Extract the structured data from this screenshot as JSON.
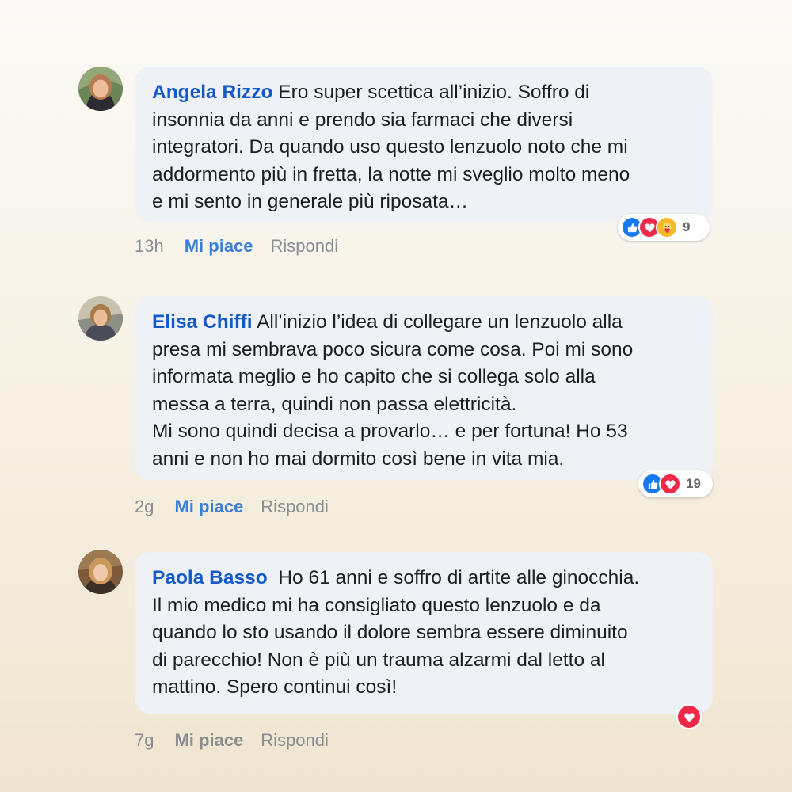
{
  "colors": {
    "author": "#1359c9",
    "like_active": "#3b7fd9",
    "like_inactive": "#8a8d91",
    "bubble": "#eef1f5"
  },
  "comments": [
    {
      "author": "Angela Rizzo",
      "text": "Ero super scettica all’inizio. Soffro di\ninsonnia da anni e prendo sia farmaci che diversi\nintegratori. Da quando uso questo lenzuolo noto che mi\naddormento più in fretta, la notte mi sveglio molto meno\ne mi sento in generale più riposata…",
      "reactions": {
        "icons": [
          "like-icon",
          "love-icon",
          "care-icon"
        ],
        "count": "9"
      },
      "time": "13h",
      "like_label": "Mi piace",
      "like_active": true,
      "reply_label": "Rispondi"
    },
    {
      "author": "Elisa Chiffi",
      "text": "All’inizio l’idea di collegare un lenzuolo alla\npresa mi sembrava poco sicura come cosa. Poi mi sono\ninformata meglio e ho capito che si collega solo alla\nmessa a terra, quindi non passa elettricità.\nMi sono quindi decisa a provarlo… e per fortuna! Ho 53\nanni e non ho mai dormito così bene in vita mia.",
      "reactions": {
        "icons": [
          "like-icon",
          "love-icon"
        ],
        "count": "19"
      },
      "time": "2g",
      "like_label": "Mi piace",
      "like_active": true,
      "reply_label": "Rispondi"
    },
    {
      "author": "Paola Basso",
      "text": "Ho 61 anni e soffro di artite alle ginocchia.\nIl mio medico mi ha consigliato questo lenzuolo e da\nquando lo sto usando il dolore sembra essere diminuito\ndi parecchio! Non è più un trauma alzarmi dal letto al\nmattino. Spero continui così!",
      "reactions": {
        "icons": [
          "love-icon"
        ],
        "count": ""
      },
      "time": "7g",
      "like_label": "Mi piace",
      "like_active": false,
      "reply_label": "Rispondi"
    }
  ]
}
